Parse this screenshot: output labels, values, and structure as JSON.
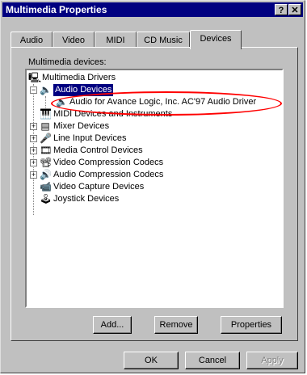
{
  "window": {
    "title": "Multimedia Properties",
    "help_label": "?",
    "close_label": "✕"
  },
  "tabs": [
    {
      "label": "Audio",
      "active": false
    },
    {
      "label": "Video",
      "active": false
    },
    {
      "label": "MIDI",
      "active": false
    },
    {
      "label": "CD Music",
      "active": false
    },
    {
      "label": "Devices",
      "active": true
    }
  ],
  "devices": {
    "section_label": "Multimedia devices:",
    "tree": {
      "root": "Multimedia Drivers",
      "items": [
        {
          "label": "Audio Devices",
          "selected": true,
          "expanded": true,
          "icon": "speaker-icon"
        },
        {
          "label": "Audio for Avance Logic, Inc. AC'97 Audio Driver",
          "child": true,
          "icon": "speaker-icon"
        },
        {
          "label": "MIDI Devices and Instruments",
          "icon": "midi-icon"
        },
        {
          "label": "Mixer Devices",
          "icon": "mixer-icon"
        },
        {
          "label": "Line Input Devices",
          "icon": "line-input-icon"
        },
        {
          "label": "Media Control Devices",
          "icon": "media-control-icon"
        },
        {
          "label": "Video Compression Codecs",
          "icon": "video-codec-icon"
        },
        {
          "label": "Audio Compression Codecs",
          "icon": "audio-codec-icon"
        },
        {
          "label": "Video Capture Devices",
          "icon": "video-capture-icon"
        },
        {
          "label": "Joystick Devices",
          "icon": "joystick-icon"
        }
      ]
    },
    "buttons": {
      "add": "Add...",
      "remove": "Remove",
      "properties": "Properties"
    }
  },
  "footer": {
    "ok": "OK",
    "cancel": "Cancel",
    "apply": "Apply"
  },
  "colors": {
    "titlebar": "#000080",
    "highlight": "#000080",
    "annotation": "#ff0000",
    "face": "#c0c0c0"
  }
}
